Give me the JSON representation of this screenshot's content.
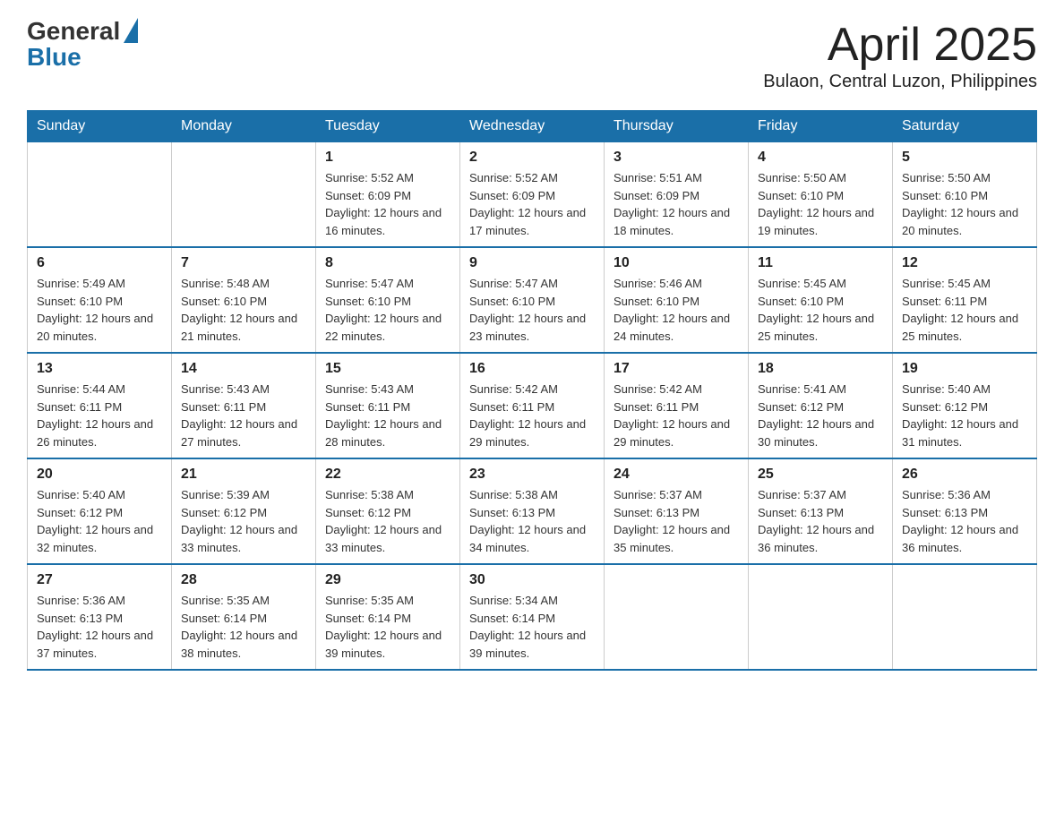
{
  "header": {
    "logo_general": "General",
    "logo_blue": "Blue",
    "title": "April 2025",
    "subtitle": "Bulaon, Central Luzon, Philippines"
  },
  "calendar": {
    "days_of_week": [
      "Sunday",
      "Monday",
      "Tuesday",
      "Wednesday",
      "Thursday",
      "Friday",
      "Saturday"
    ],
    "weeks": [
      [
        {
          "day": "",
          "sunrise": "",
          "sunset": "",
          "daylight": ""
        },
        {
          "day": "",
          "sunrise": "",
          "sunset": "",
          "daylight": ""
        },
        {
          "day": "1",
          "sunrise": "Sunrise: 5:52 AM",
          "sunset": "Sunset: 6:09 PM",
          "daylight": "Daylight: 12 hours and 16 minutes."
        },
        {
          "day": "2",
          "sunrise": "Sunrise: 5:52 AM",
          "sunset": "Sunset: 6:09 PM",
          "daylight": "Daylight: 12 hours and 17 minutes."
        },
        {
          "day": "3",
          "sunrise": "Sunrise: 5:51 AM",
          "sunset": "Sunset: 6:09 PM",
          "daylight": "Daylight: 12 hours and 18 minutes."
        },
        {
          "day": "4",
          "sunrise": "Sunrise: 5:50 AM",
          "sunset": "Sunset: 6:10 PM",
          "daylight": "Daylight: 12 hours and 19 minutes."
        },
        {
          "day": "5",
          "sunrise": "Sunrise: 5:50 AM",
          "sunset": "Sunset: 6:10 PM",
          "daylight": "Daylight: 12 hours and 20 minutes."
        }
      ],
      [
        {
          "day": "6",
          "sunrise": "Sunrise: 5:49 AM",
          "sunset": "Sunset: 6:10 PM",
          "daylight": "Daylight: 12 hours and 20 minutes."
        },
        {
          "day": "7",
          "sunrise": "Sunrise: 5:48 AM",
          "sunset": "Sunset: 6:10 PM",
          "daylight": "Daylight: 12 hours and 21 minutes."
        },
        {
          "day": "8",
          "sunrise": "Sunrise: 5:47 AM",
          "sunset": "Sunset: 6:10 PM",
          "daylight": "Daylight: 12 hours and 22 minutes."
        },
        {
          "day": "9",
          "sunrise": "Sunrise: 5:47 AM",
          "sunset": "Sunset: 6:10 PM",
          "daylight": "Daylight: 12 hours and 23 minutes."
        },
        {
          "day": "10",
          "sunrise": "Sunrise: 5:46 AM",
          "sunset": "Sunset: 6:10 PM",
          "daylight": "Daylight: 12 hours and 24 minutes."
        },
        {
          "day": "11",
          "sunrise": "Sunrise: 5:45 AM",
          "sunset": "Sunset: 6:10 PM",
          "daylight": "Daylight: 12 hours and 25 minutes."
        },
        {
          "day": "12",
          "sunrise": "Sunrise: 5:45 AM",
          "sunset": "Sunset: 6:11 PM",
          "daylight": "Daylight: 12 hours and 25 minutes."
        }
      ],
      [
        {
          "day": "13",
          "sunrise": "Sunrise: 5:44 AM",
          "sunset": "Sunset: 6:11 PM",
          "daylight": "Daylight: 12 hours and 26 minutes."
        },
        {
          "day": "14",
          "sunrise": "Sunrise: 5:43 AM",
          "sunset": "Sunset: 6:11 PM",
          "daylight": "Daylight: 12 hours and 27 minutes."
        },
        {
          "day": "15",
          "sunrise": "Sunrise: 5:43 AM",
          "sunset": "Sunset: 6:11 PM",
          "daylight": "Daylight: 12 hours and 28 minutes."
        },
        {
          "day": "16",
          "sunrise": "Sunrise: 5:42 AM",
          "sunset": "Sunset: 6:11 PM",
          "daylight": "Daylight: 12 hours and 29 minutes."
        },
        {
          "day": "17",
          "sunrise": "Sunrise: 5:42 AM",
          "sunset": "Sunset: 6:11 PM",
          "daylight": "Daylight: 12 hours and 29 minutes."
        },
        {
          "day": "18",
          "sunrise": "Sunrise: 5:41 AM",
          "sunset": "Sunset: 6:12 PM",
          "daylight": "Daylight: 12 hours and 30 minutes."
        },
        {
          "day": "19",
          "sunrise": "Sunrise: 5:40 AM",
          "sunset": "Sunset: 6:12 PM",
          "daylight": "Daylight: 12 hours and 31 minutes."
        }
      ],
      [
        {
          "day": "20",
          "sunrise": "Sunrise: 5:40 AM",
          "sunset": "Sunset: 6:12 PM",
          "daylight": "Daylight: 12 hours and 32 minutes."
        },
        {
          "day": "21",
          "sunrise": "Sunrise: 5:39 AM",
          "sunset": "Sunset: 6:12 PM",
          "daylight": "Daylight: 12 hours and 33 minutes."
        },
        {
          "day": "22",
          "sunrise": "Sunrise: 5:38 AM",
          "sunset": "Sunset: 6:12 PM",
          "daylight": "Daylight: 12 hours and 33 minutes."
        },
        {
          "day": "23",
          "sunrise": "Sunrise: 5:38 AM",
          "sunset": "Sunset: 6:13 PM",
          "daylight": "Daylight: 12 hours and 34 minutes."
        },
        {
          "day": "24",
          "sunrise": "Sunrise: 5:37 AM",
          "sunset": "Sunset: 6:13 PM",
          "daylight": "Daylight: 12 hours and 35 minutes."
        },
        {
          "day": "25",
          "sunrise": "Sunrise: 5:37 AM",
          "sunset": "Sunset: 6:13 PM",
          "daylight": "Daylight: 12 hours and 36 minutes."
        },
        {
          "day": "26",
          "sunrise": "Sunrise: 5:36 AM",
          "sunset": "Sunset: 6:13 PM",
          "daylight": "Daylight: 12 hours and 36 minutes."
        }
      ],
      [
        {
          "day": "27",
          "sunrise": "Sunrise: 5:36 AM",
          "sunset": "Sunset: 6:13 PM",
          "daylight": "Daylight: 12 hours and 37 minutes."
        },
        {
          "day": "28",
          "sunrise": "Sunrise: 5:35 AM",
          "sunset": "Sunset: 6:14 PM",
          "daylight": "Daylight: 12 hours and 38 minutes."
        },
        {
          "day": "29",
          "sunrise": "Sunrise: 5:35 AM",
          "sunset": "Sunset: 6:14 PM",
          "daylight": "Daylight: 12 hours and 39 minutes."
        },
        {
          "day": "30",
          "sunrise": "Sunrise: 5:34 AM",
          "sunset": "Sunset: 6:14 PM",
          "daylight": "Daylight: 12 hours and 39 minutes."
        },
        {
          "day": "",
          "sunrise": "",
          "sunset": "",
          "daylight": ""
        },
        {
          "day": "",
          "sunrise": "",
          "sunset": "",
          "daylight": ""
        },
        {
          "day": "",
          "sunrise": "",
          "sunset": "",
          "daylight": ""
        }
      ]
    ]
  }
}
